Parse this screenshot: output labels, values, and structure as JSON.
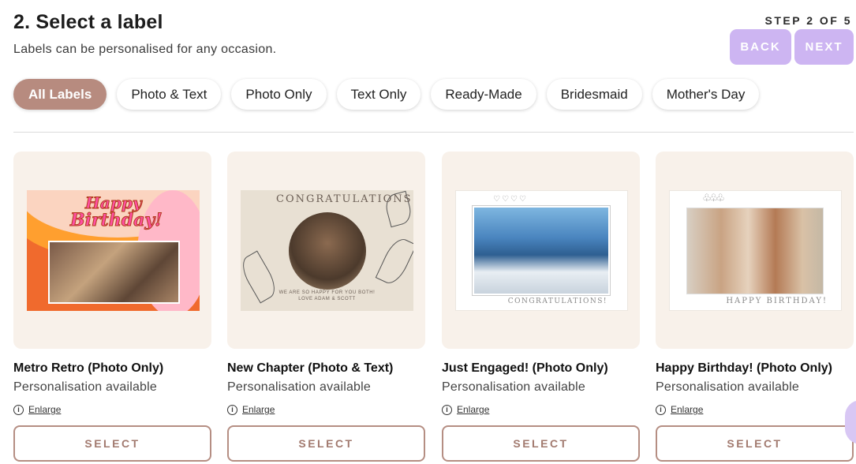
{
  "header": {
    "title": "2. Select a label",
    "subtitle": "Labels can be personalised for any occasion.",
    "step": "STEP 2 OF 5",
    "back_label": "BACK",
    "next_label": "NEXT"
  },
  "filters": [
    {
      "label": "All Labels",
      "active": true
    },
    {
      "label": "Photo & Text",
      "active": false
    },
    {
      "label": "Photo Only",
      "active": false
    },
    {
      "label": "Text Only",
      "active": false
    },
    {
      "label": "Ready-Made",
      "active": false
    },
    {
      "label": "Bridesmaid",
      "active": false
    },
    {
      "label": "Mother's Day",
      "active": false
    }
  ],
  "cards": [
    {
      "title": "Metro Retro (Photo Only)",
      "subtitle": "Personalisation available",
      "enlarge": "Enlarge",
      "select": "SELECT",
      "art": {
        "line1": "Happy",
        "line2": "Birthday!"
      }
    },
    {
      "title": "New Chapter (Photo & Text)",
      "subtitle": "Personalisation available",
      "enlarge": "Enlarge",
      "select": "SELECT",
      "art": {
        "heading": "CONGRATULATIONS",
        "footer_line1": "WE ARE SO HAPPY FOR YOU BOTH!",
        "footer_line2": "LOVE ADAM & SCOTT"
      }
    },
    {
      "title": "Just Engaged! (Photo Only)",
      "subtitle": "Personalisation available",
      "enlarge": "Enlarge",
      "select": "SELECT",
      "art": {
        "hearts": "♡♡♡♡",
        "caption": "CONGRATULATIONS!"
      }
    },
    {
      "title": "Happy Birthday! (Photo Only)",
      "subtitle": "Personalisation available",
      "enlarge": "Enlarge",
      "select": "SELECT",
      "art": {
        "balloons": "♧♧♧",
        "caption": "HAPPY BIRTHDAY!"
      }
    }
  ],
  "colors": {
    "accent_chip": "#b78b7f",
    "nav_button": "#cdb5f2",
    "card_bg": "#f8f1ea",
    "select_border": "#b58e83"
  }
}
